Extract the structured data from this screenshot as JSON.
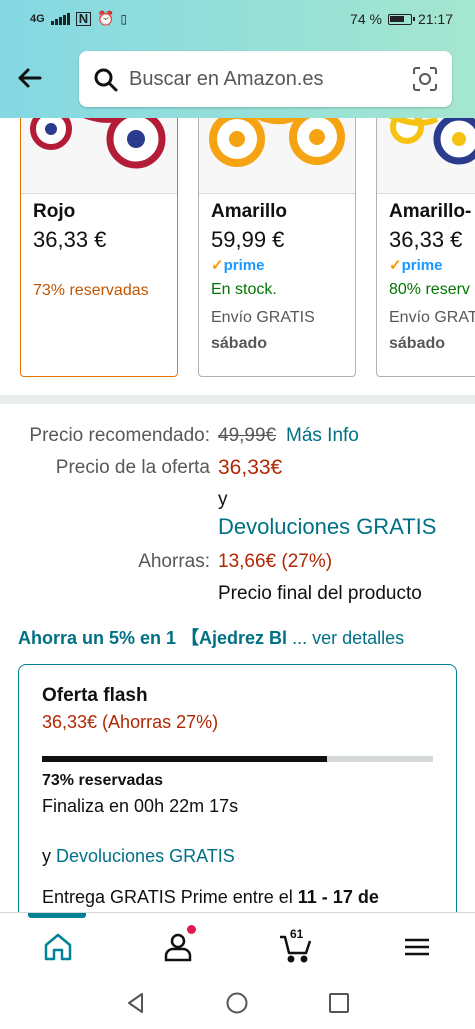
{
  "status_bar": {
    "network": "4G",
    "battery_percent": "74 %",
    "time": "21:17"
  },
  "header": {
    "search_placeholder": "Buscar en Amazon.es"
  },
  "variants": [
    {
      "name": "Rojo",
      "price": "36,33 €",
      "prime": false,
      "line1": "73% reservadas",
      "line1_color": "#c45500",
      "line2": "",
      "line3": "",
      "selected": true
    },
    {
      "name": "Amarillo",
      "price": "59,99 €",
      "prime": true,
      "line1": "En stock.",
      "line1_color": "#007600",
      "line2": "Envío GRATIS",
      "line3": "sábado",
      "selected": false
    },
    {
      "name": "Amarillo-",
      "price": "36,33 €",
      "prime": true,
      "line1": "80% reserv",
      "line1_color": "#007600",
      "line2": "Envío GRAT",
      "line3": "sábado",
      "selected": false
    }
  ],
  "prime_label": "prime",
  "pricing": {
    "recommended_label": "Precio recomendado:",
    "recommended_value": "49,99€",
    "more_info": "Más Info",
    "offer_label": "Precio de la oferta",
    "offer_value": "36,33€",
    "and": "y",
    "free_returns": "Devoluciones GRATIS",
    "savings_label": "Ahorras:",
    "savings_value": "13,66€ (27%)",
    "final_price_note": "Precio final del producto"
  },
  "promo": {
    "text": "Ahorra un 5% en 1 【Ajedrez Bl",
    "more": "... ver detalles"
  },
  "flash_deal": {
    "title": "Oferta flash",
    "price": "36,33€ (Ahorras 27%)",
    "claimed_percent": 73,
    "claimed_label": "73% reservadas",
    "ends": "Finaliza en 00h 22m 17s",
    "returns_prefix": "y",
    "returns_link": "Devoluciones GRATIS",
    "delivery_prefix": "Entrega GRATIS Prime entre el",
    "delivery_dates": "11 - 17 de"
  },
  "bottom_nav": {
    "cart_count": "61",
    "items": [
      "home-icon",
      "account-icon",
      "cart-icon",
      "menu-icon"
    ]
  },
  "colors": {
    "accent_teal": "#008296",
    "link": "#007185",
    "price_red": "#b12704",
    "selected_border": "#e77600"
  }
}
